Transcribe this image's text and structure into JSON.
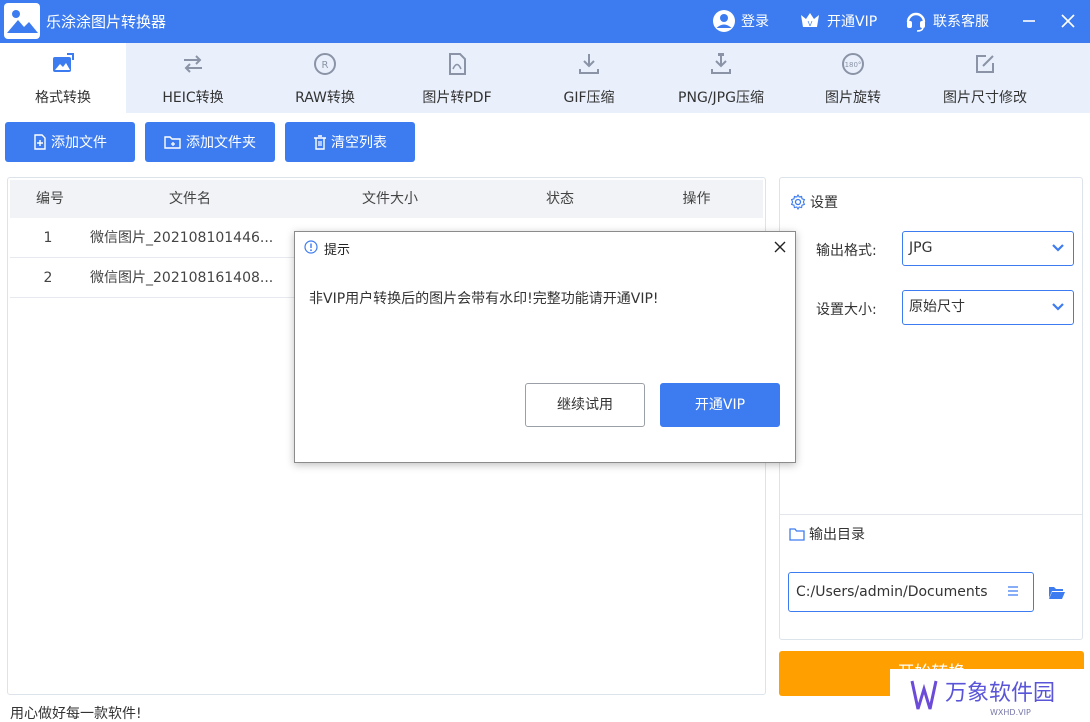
{
  "app": {
    "title": "乐涂涂图片转换器"
  },
  "titlebar": {
    "login_label": "登录",
    "vip_label": "开通VIP",
    "support_label": "联系客服"
  },
  "tabs": [
    {
      "label": "格式转换",
      "icon": "image-convert-icon",
      "active": true
    },
    {
      "label": "HEIC转换",
      "icon": "swap-arrows-icon"
    },
    {
      "label": "RAW转换",
      "icon": "raw-circle-icon"
    },
    {
      "label": "图片转PDF",
      "icon": "pdf-file-icon"
    },
    {
      "label": "GIF压缩",
      "icon": "compress-down-icon"
    },
    {
      "label": "PNG/JPG压缩",
      "icon": "compress-file-icon"
    },
    {
      "label": "图片旋转",
      "icon": "rotate-180-icon"
    },
    {
      "label": "图片尺寸修改",
      "icon": "edit-square-icon"
    }
  ],
  "toolbar": {
    "add_file_label": "添加文件",
    "add_folder_label": "添加文件夹",
    "clear_list_label": "清空列表"
  },
  "table": {
    "columns": [
      "编号",
      "文件名",
      "文件大小",
      "状态",
      "操作"
    ],
    "rows": [
      {
        "num": "1",
        "name": "微信图片_202108101446..."
      },
      {
        "num": "2",
        "name": "微信图片_202108161408..."
      }
    ]
  },
  "settings": {
    "heading": "设置",
    "format_label": "输出格式:",
    "format_value": "JPG",
    "size_label": "设置大小:",
    "size_value": "原始尺寸",
    "output_heading": "输出目录",
    "output_path": "C:/Users/admin/Documents"
  },
  "start_button_label": "开始转换",
  "status_text": "用心做好每一款软件!",
  "watermark": {
    "brand": "万象软件园",
    "sub": "WXHD.VIP"
  },
  "dialog": {
    "title": "提示",
    "message": "非VIP用户转换后的图片会带有水印!完整功能请开通VIP!",
    "continue_label": "继续试用",
    "vip_label": "开通VIP"
  },
  "colors": {
    "accent": "#3d7cf0",
    "start": "#ff9f00",
    "tab_bg": "#e9f0fc"
  }
}
